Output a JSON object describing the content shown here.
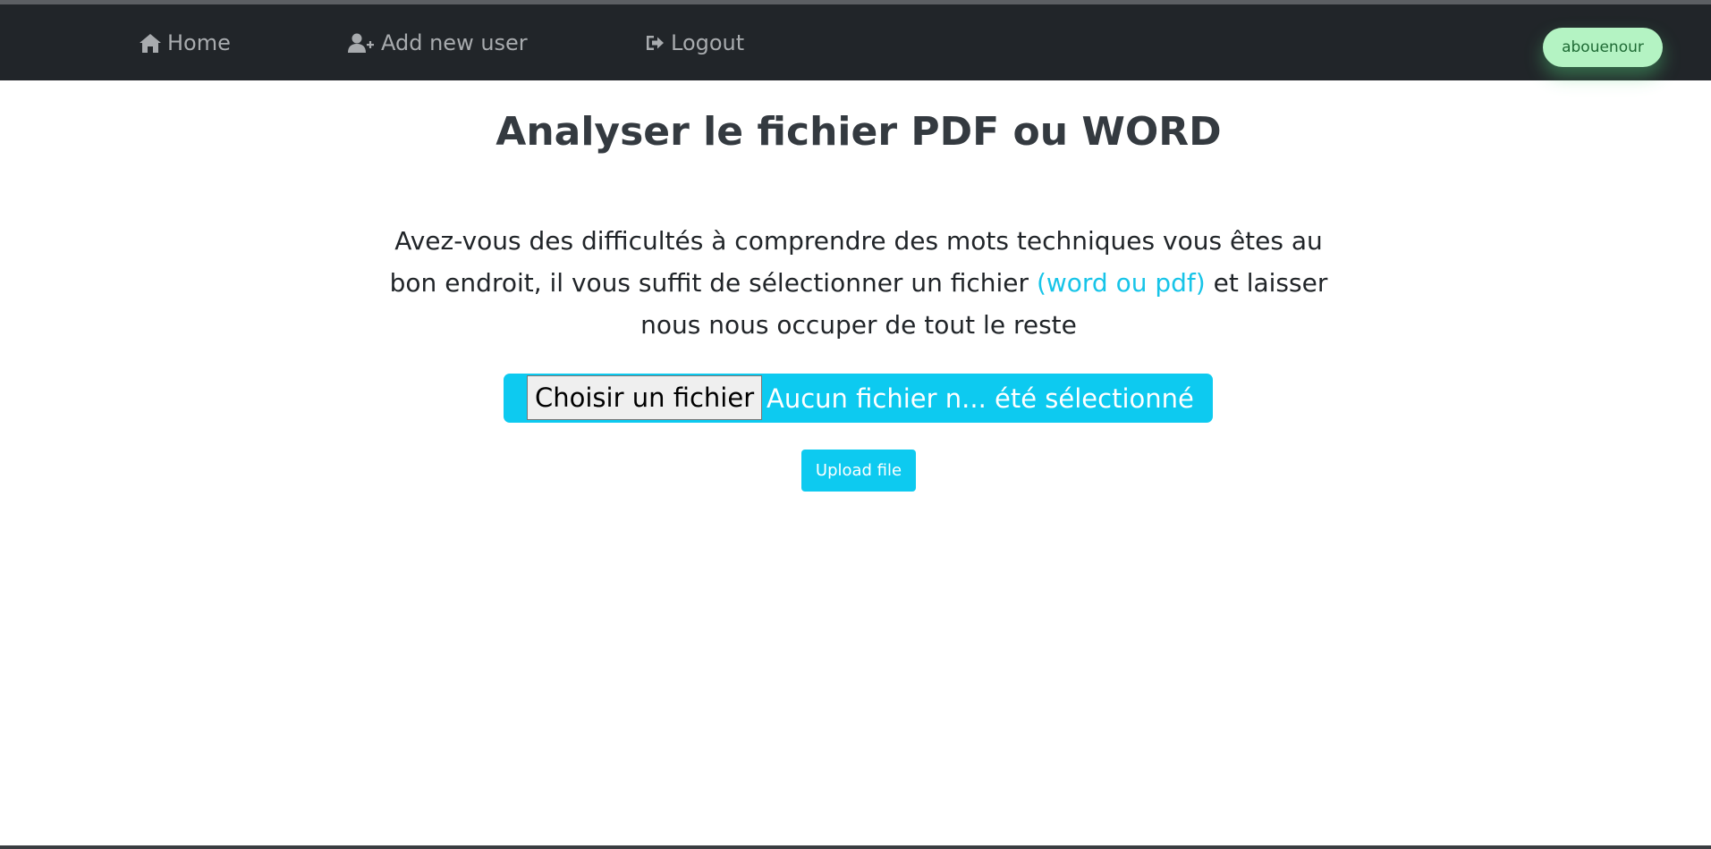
{
  "nav": {
    "home_label": "Home",
    "add_user_label": "Add new user",
    "logout_label": "Logout",
    "user_name": "abouenour"
  },
  "main": {
    "title": "Analyser le fichier PDF ou WORD",
    "description_part1": "Avez-vous des difficultés à comprendre des mots techniques vous êtes au bon endroit, il vous suffit de sélectionner un fichier ",
    "description_highlight": "(word ou pdf)",
    "description_part2": " et laisser nous nous occuper de tout le reste",
    "file_button_label": "Choisir un fichier",
    "file_status": "Aucun fichier n... été sélectionné",
    "upload_label": "Upload file"
  },
  "colors": {
    "navbar": "#212529",
    "accent": "#0dcaf0",
    "highlight_text": "#17c4e8",
    "user_pill": "#b4f3c3"
  },
  "icons": {
    "home": "home-icon",
    "add_user": "user-plus-icon",
    "logout": "logout-icon"
  }
}
